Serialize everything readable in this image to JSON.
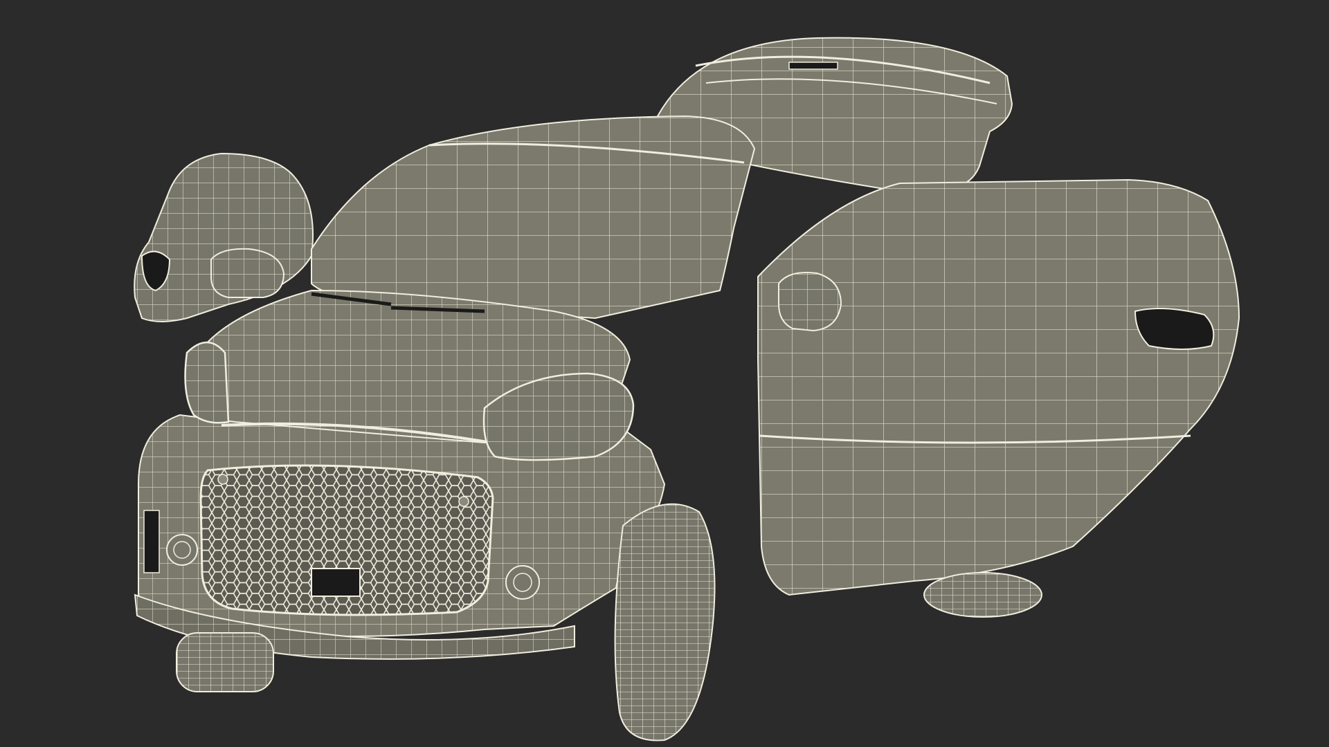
{
  "scene": {
    "subject": "car-wireframe-render",
    "background_color": "#2b2b2b",
    "body_color": "#7b7a6c",
    "body_shade_color": "#64635a",
    "dark_color": "#1a1a1a",
    "wire_color": "#f1eedf",
    "grille_color": "#5c5b51"
  }
}
